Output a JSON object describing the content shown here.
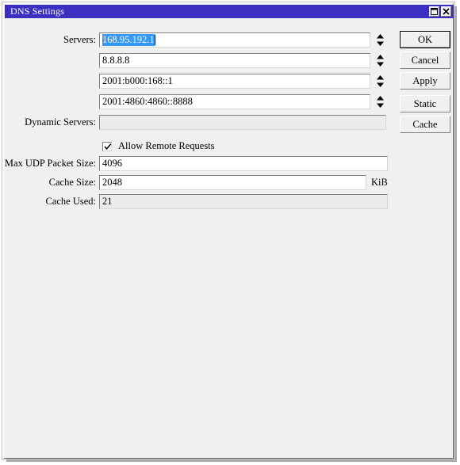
{
  "window": {
    "title": "DNS Settings",
    "titlebar_color": "#3c30c0",
    "background_color": "#f0f0f0",
    "buttons": [
      {
        "name": "maximize",
        "icon": "maximize-icon"
      },
      {
        "name": "close",
        "icon": "close-icon"
      }
    ]
  },
  "form": {
    "servers": {
      "label": "Servers:",
      "entries": [
        {
          "value": "168.95.192.1",
          "selected": true,
          "has_spinner": true
        },
        {
          "value": "8.8.8.8",
          "selected": false,
          "has_spinner": true
        },
        {
          "value": "2001:b000:168::1",
          "selected": false,
          "has_spinner": true
        },
        {
          "value": "2001:4860:4860::8888",
          "selected": false,
          "has_spinner": true
        }
      ]
    },
    "dynamic_servers": {
      "label": "Dynamic Servers:",
      "value": "",
      "disabled": true
    },
    "allow_remote_requests": {
      "label": "Allow Remote Requests",
      "checked": true
    },
    "max_udp_packet_size": {
      "label": "Max UDP Packet Size:",
      "value": "4096"
    },
    "cache_size": {
      "label": "Cache Size:",
      "value": "2048",
      "unit": "KiB"
    },
    "cache_used": {
      "label": "Cache Used:",
      "value": "21",
      "disabled": true
    }
  },
  "actions": {
    "ok": "OK",
    "cancel": "Cancel",
    "apply": "Apply",
    "static": "Static",
    "cache": "Cache"
  },
  "colors": {
    "selection": "#3399ff",
    "title_bar": "#3c30c0",
    "face": "#f0f0f0",
    "disabled_field": "#ebebeb"
  }
}
